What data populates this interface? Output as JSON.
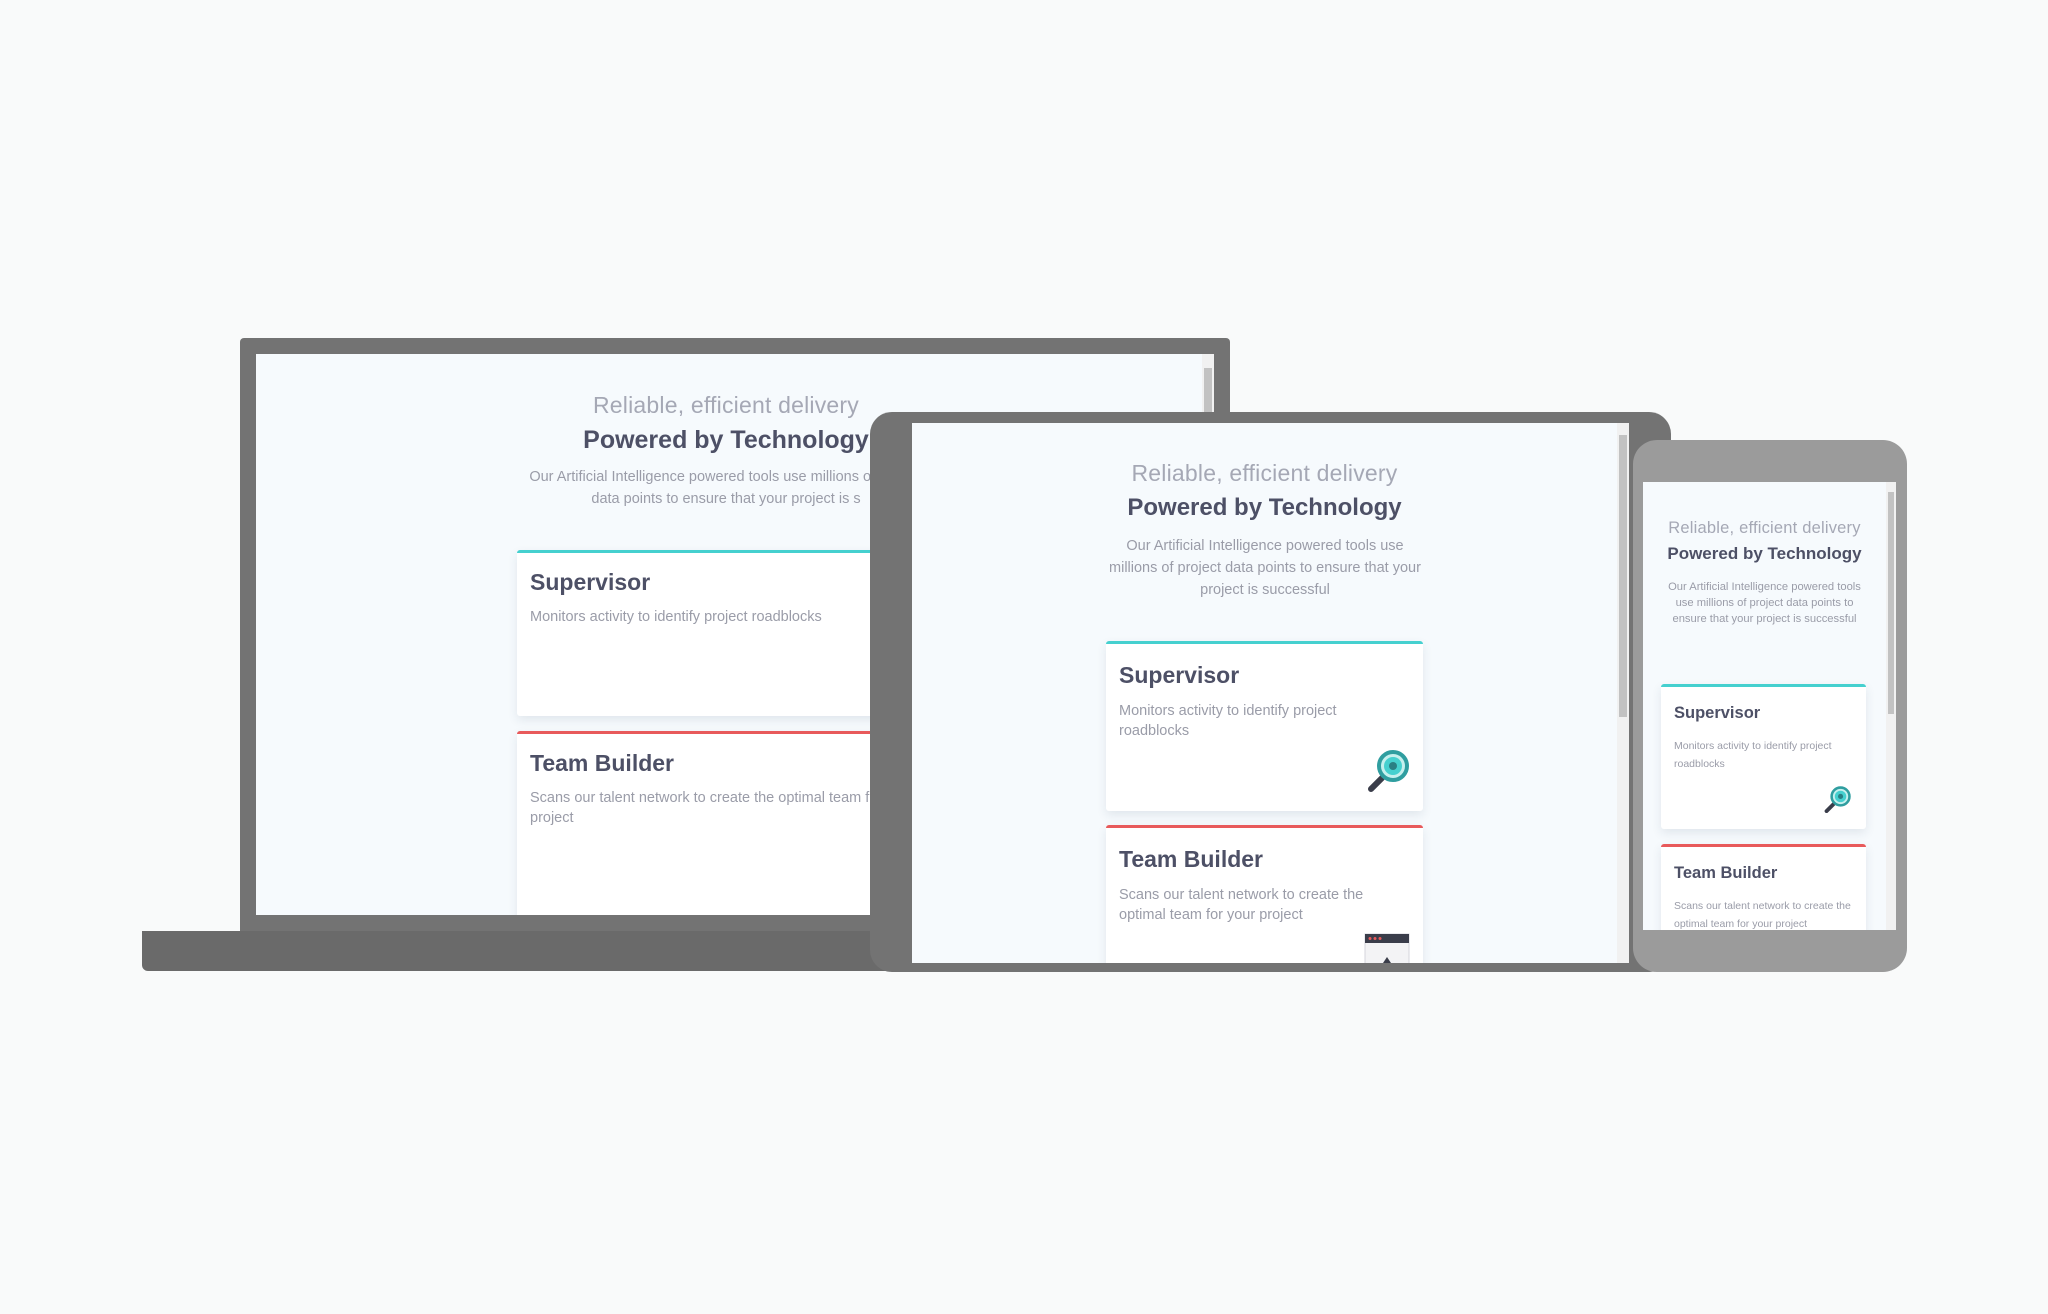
{
  "colors": {
    "background": "#f9fafa",
    "device_frame": "#737373",
    "phone_frame": "#9b9b9b",
    "screen_bg": "#f6fafd",
    "accent_cyan": "#45d0cf",
    "accent_red": "#e85a5b",
    "heading": "#4d5066",
    "muted": "#9a9ca8"
  },
  "hero": {
    "eyebrow": "Reliable, efficient delivery",
    "title": "Powered by Technology",
    "description": "Our Artificial Intelligence powered tools use millions of project data points to ensure that your project is successful"
  },
  "laptop": {
    "description_visible": "Our Artificial Intelligence powered tools use millions of project data points to ensure that your project is s"
  },
  "cards": [
    {
      "title": "Supervisor",
      "description": "Monitors activity to identify project roadblocks",
      "accent": "cyan",
      "icon": "magnifier-icon"
    },
    {
      "title": "Team Builder",
      "description": "Scans our talent network to create the optimal team for your project",
      "accent": "red",
      "icon": "browser-window-icon"
    }
  ]
}
